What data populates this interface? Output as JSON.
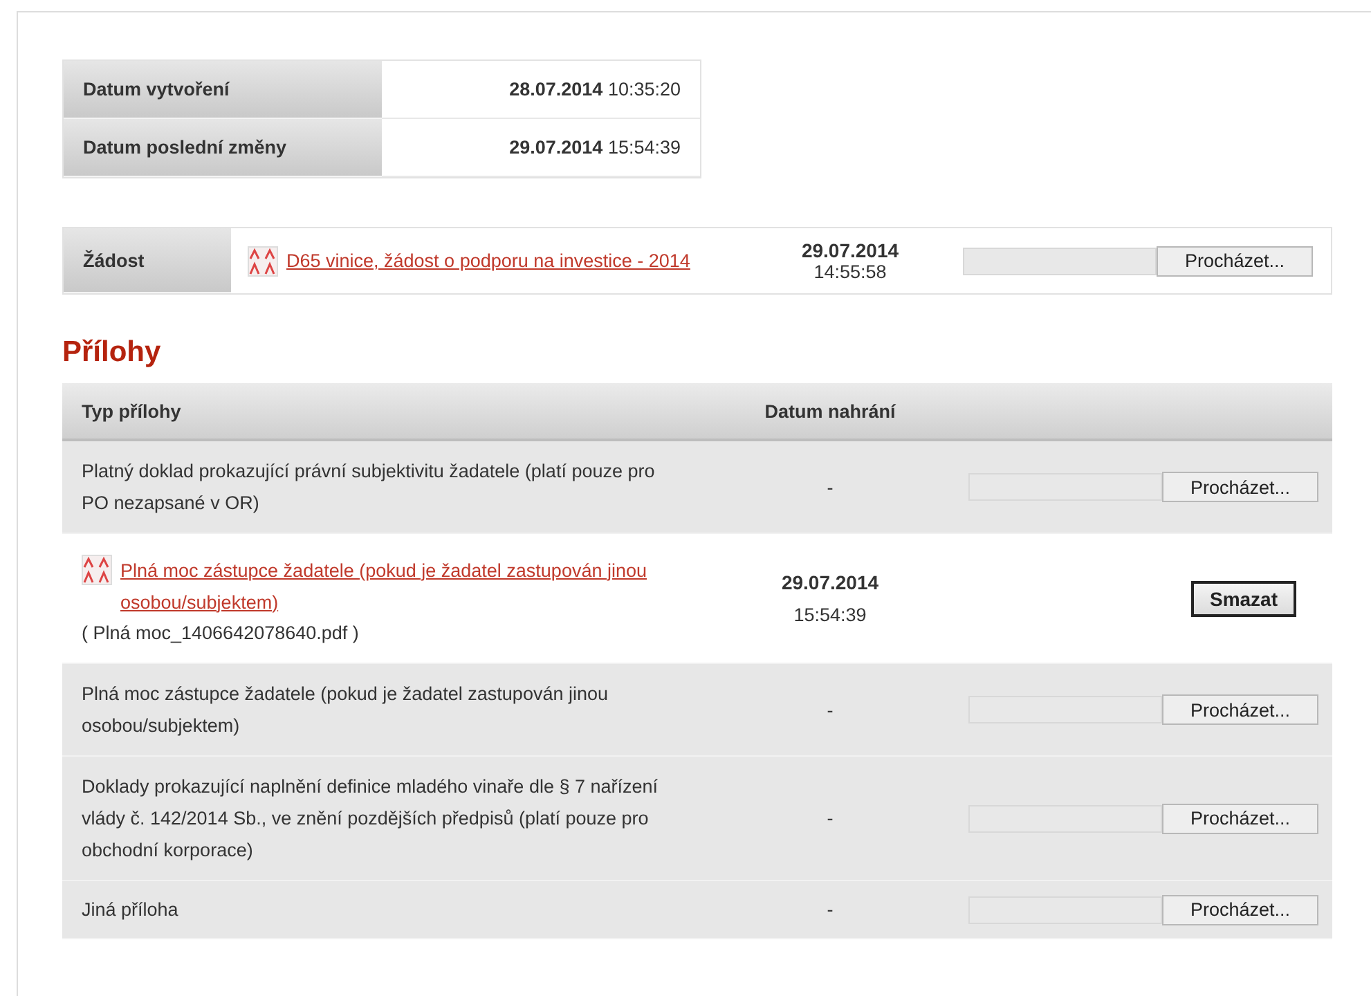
{
  "info": [
    {
      "label": "Datum vytvoření",
      "date": "28.07.2014",
      "time": "10:35:20"
    },
    {
      "label": "Datum poslední změny",
      "date": "29.07.2014",
      "time": "15:54:39"
    }
  ],
  "request": {
    "label": "Žádost",
    "link": "D65 vinice, žádost o podporu na investice - 2014",
    "date": "29.07.2014",
    "time": "14:55:58",
    "button": "Procházet..."
  },
  "attachments": {
    "title": "Přílohy",
    "columns": [
      "Typ přílohy",
      "Datum nahrání"
    ],
    "rows": [
      {
        "kind": "empty",
        "label": "Platný doklad prokazující právní subjektivitu žadatele (platí pouze pro PO nezapsané v OR)",
        "date": "-",
        "button": "Procházet..."
      },
      {
        "kind": "uploaded",
        "label": "Plná moc zástupce žadatele (pokud je žadatel zastupován jinou osobou/subjektem)",
        "filename": "( Plná moc_1406642078640.pdf )",
        "date": "29.07.2014",
        "time": "15:54:39",
        "button": "Smazat"
      },
      {
        "kind": "empty",
        "label": "Plná moc zástupce žadatele (pokud je žadatel zastupován jinou osobou/subjektem)",
        "date": "-",
        "button": "Procházet..."
      },
      {
        "kind": "empty",
        "label": "Doklady prokazující naplnění definice mladého vinaře dle § 7 nařízení vlády č. 142/2014 Sb., ve znění pozdějších předpisů (platí pouze pro obchodní korporace)",
        "date": "-",
        "button": "Procházet..."
      },
      {
        "kind": "empty",
        "label": "Jiná příloha",
        "date": "-",
        "button": "Procházet..."
      }
    ]
  }
}
